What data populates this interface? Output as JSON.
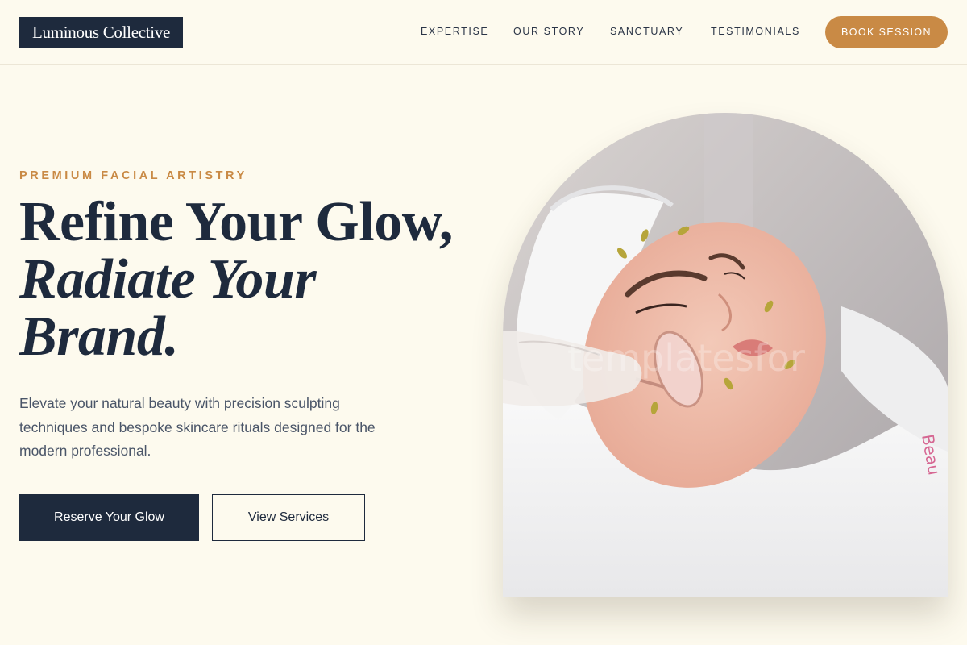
{
  "header": {
    "logo": "Luminous Collective",
    "nav": [
      {
        "label": "EXPERTISE"
      },
      {
        "label": "OUR STORY"
      },
      {
        "label": "SANCTUARY"
      },
      {
        "label": "TESTIMONIALS"
      }
    ],
    "cta": "BOOK SESSION"
  },
  "hero": {
    "eyebrow": "PREMIUM FACIAL ARTISTRY",
    "headline_line1": "Refine Your Glow,",
    "headline_line2": "Radiate Your",
    "headline_line3": "Brand.",
    "lede": "Elevate your natural beauty with precision sculpting techniques and bespoke skincare rituals designed for the modern professional.",
    "primary_cta": "Reserve Your Glow",
    "secondary_cta": "View Services",
    "image_watermark": "templatesfor",
    "image_icon": "facial-treatment-photo"
  },
  "colors": {
    "background": "#fdfaee",
    "navy": "#1e2a3d",
    "accent": "#c98a45"
  }
}
